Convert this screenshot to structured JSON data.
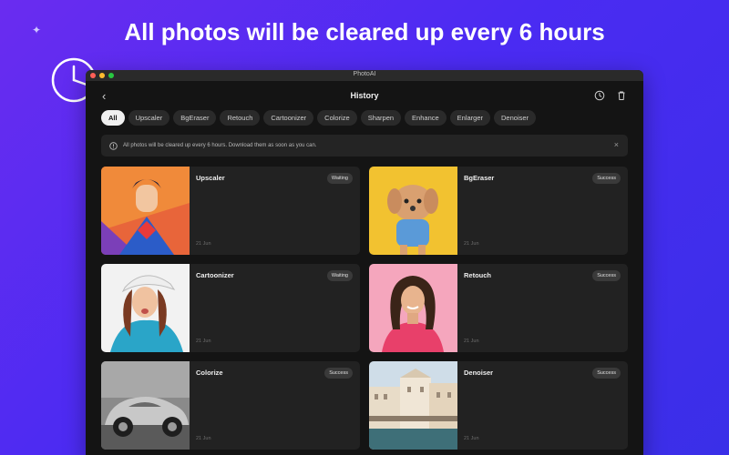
{
  "banner": {
    "headline": "All photos will be cleared up every 6 hours"
  },
  "window": {
    "app_title": "PhotoAI"
  },
  "header": {
    "title": "History"
  },
  "chips": [
    "All",
    "Upscaler",
    "BgEraser",
    "Retouch",
    "Cartoonizer",
    "Colorize",
    "Sharpen",
    "Enhance",
    "Enlarger",
    "Denoiser"
  ],
  "notice": {
    "text": "All photos will be cleared up every 6 hours. Download them as soon as you can."
  },
  "cards": [
    {
      "title": "Upscaler",
      "status": "Waiting",
      "date": "21 Jun"
    },
    {
      "title": "BgEraser",
      "status": "Success",
      "date": "21 Jun"
    },
    {
      "title": "Cartoonizer",
      "status": "Waiting",
      "date": "21 Jun"
    },
    {
      "title": "Retouch",
      "status": "Success",
      "date": "21 Jun"
    },
    {
      "title": "Colorize",
      "status": "Success",
      "date": "21 Jun"
    },
    {
      "title": "Denoiser",
      "status": "Success",
      "date": "21 Jun"
    }
  ],
  "icons": {
    "back": "chevron-left-icon",
    "history": "history-icon",
    "trash": "trash-icon",
    "info": "info-icon",
    "close": "close-icon",
    "clock": "clock-icon"
  },
  "colors": {
    "background": "#5a2cf0",
    "window": "#141414",
    "card": "#222222",
    "chip_active": "#f0f0f0"
  }
}
